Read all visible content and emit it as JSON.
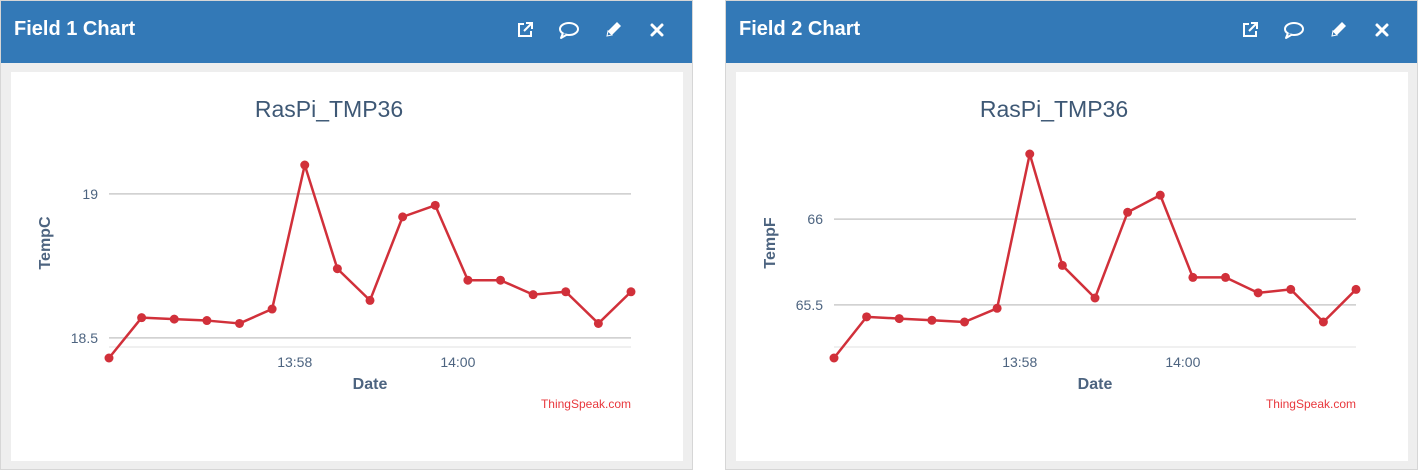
{
  "panels": [
    {
      "title": "Field 1 Chart",
      "icons": [
        "external-link-icon",
        "comment-icon",
        "pencil-icon",
        "close-icon"
      ],
      "credit": "ThingSpeak.com"
    },
    {
      "title": "Field 2 Chart",
      "icons": [
        "external-link-icon",
        "comment-icon",
        "pencil-icon",
        "close-icon"
      ],
      "credit": "ThingSpeak.com"
    }
  ],
  "colors": {
    "header_bg": "#3379b7",
    "line": "#d1303a",
    "grid": "#cccccc",
    "text": "#4d6480",
    "credit": "#e8383d"
  },
  "chart_data": [
    {
      "type": "line",
      "title": "RasPi_TMP36",
      "xlabel": "Date",
      "ylabel": "TempC",
      "x_ticks": [
        "13:58",
        "14:00"
      ],
      "y_ticks": [
        18.5,
        19
      ],
      "ylim": [
        18.43,
        19.18
      ],
      "grid": true,
      "series": [
        {
          "values": [
            18.43,
            18.57,
            18.565,
            18.56,
            18.55,
            18.6,
            19.1,
            18.74,
            18.63,
            18.92,
            18.96,
            18.7,
            18.7,
            18.65,
            18.66,
            18.55,
            18.66
          ]
        }
      ]
    },
    {
      "type": "line",
      "title": "RasPi_TMP36",
      "xlabel": "Date",
      "ylabel": "TempF",
      "x_ticks": [
        "13:58",
        "14:00"
      ],
      "y_ticks": [
        65.5,
        66
      ],
      "ylim": [
        65.19,
        66.45
      ],
      "grid": true,
      "series": [
        {
          "values": [
            65.19,
            65.43,
            65.42,
            65.41,
            65.4,
            65.48,
            66.38,
            65.73,
            65.54,
            66.04,
            66.14,
            65.66,
            65.66,
            65.57,
            65.59,
            65.4,
            65.59
          ]
        }
      ]
    }
  ]
}
